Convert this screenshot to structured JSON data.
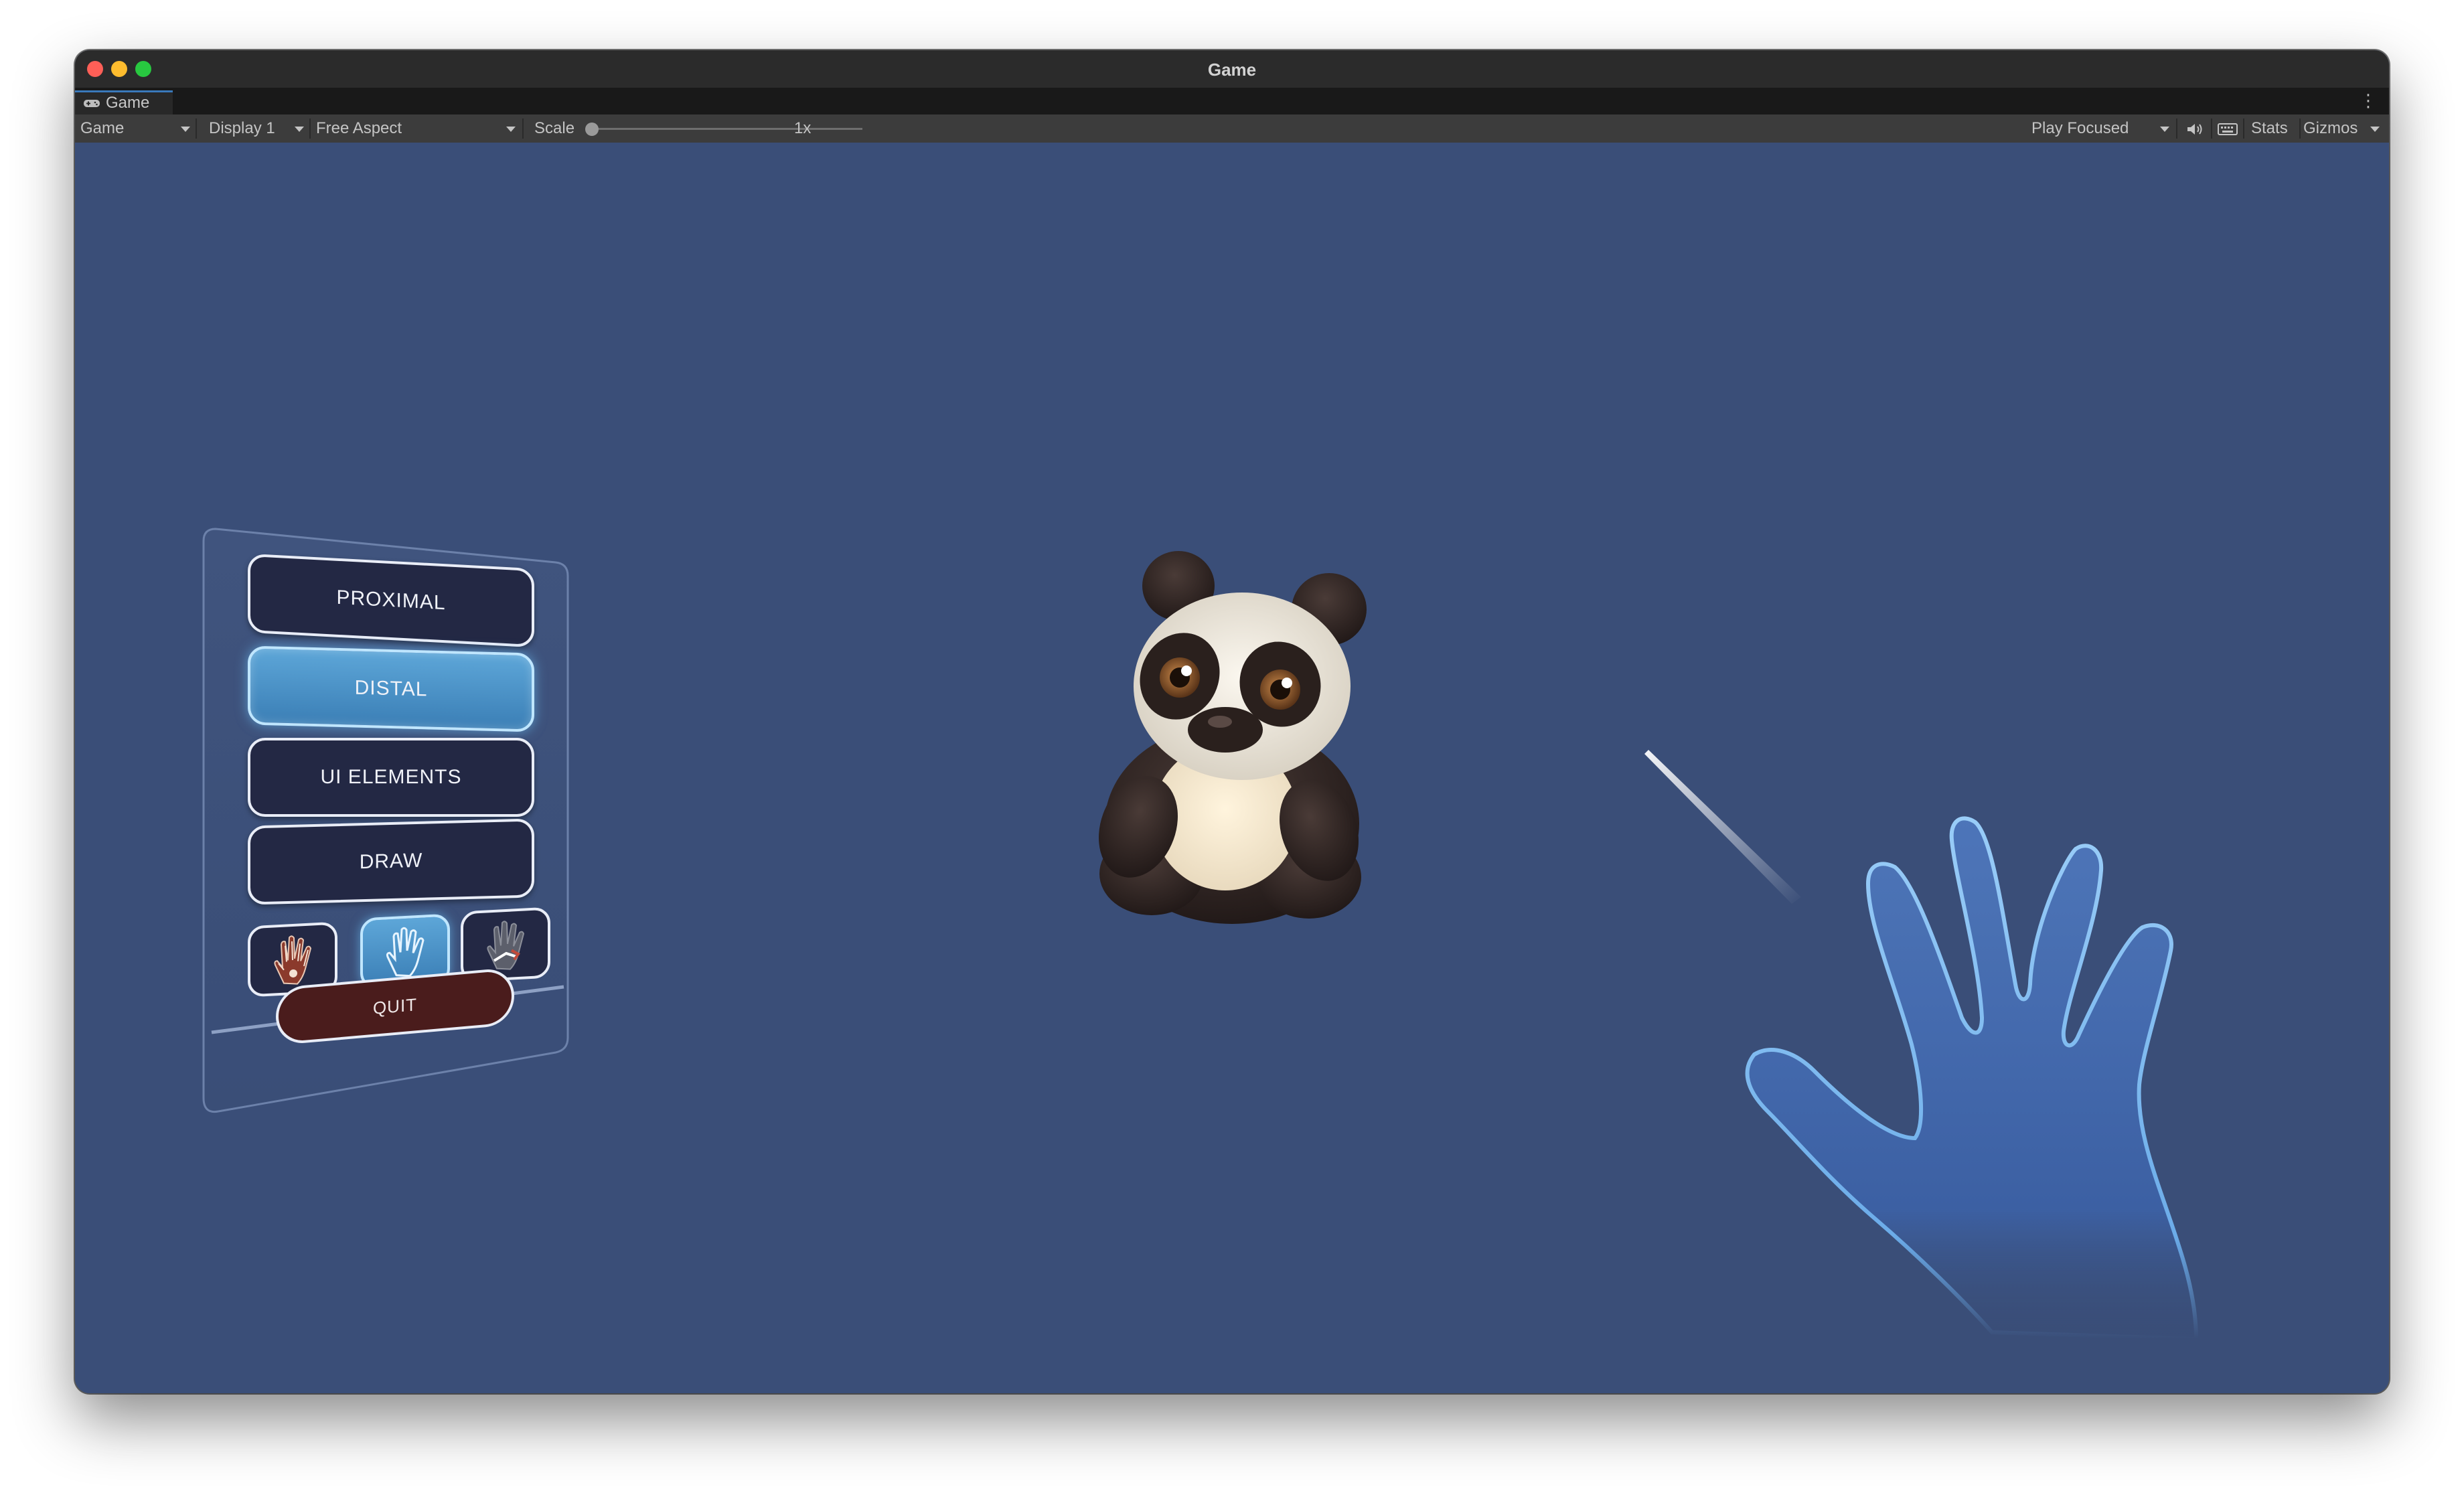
{
  "window": {
    "title": "Game"
  },
  "tabs": [
    {
      "label": "Game",
      "icon": "gamepad-icon"
    }
  ],
  "toolbar": {
    "mode": "Game",
    "display": "Display 1",
    "aspect": "Free Aspect",
    "scale_label": "Scale",
    "scale_value": "1x",
    "play_mode": "Play Focused",
    "stats": "Stats",
    "gizmos": "Gizmos",
    "icons": [
      "speaker-icon",
      "keyboard-icon",
      "kebab-menu-icon"
    ]
  },
  "menu": {
    "buttons": [
      {
        "label": "PROXIMAL",
        "active": false
      },
      {
        "label": "DISTAL",
        "active": true
      },
      {
        "label": "UI ELEMENTS",
        "active": false
      },
      {
        "label": "DRAW",
        "active": false
      }
    ],
    "hand_options": [
      {
        "icon": "skeleton-hand-icon",
        "active": false
      },
      {
        "icon": "ghost-hand-icon",
        "active": true
      },
      {
        "icon": "occlusion-hand-icon",
        "active": false
      }
    ],
    "quit_label": "QUIT"
  },
  "scene": {
    "objects": [
      "panda-model",
      "ray-pointer",
      "virtual-hand"
    ],
    "colors": {
      "background": "#3a4e78",
      "accent": "#5da6d8",
      "quit": "#4a1c1c"
    }
  }
}
